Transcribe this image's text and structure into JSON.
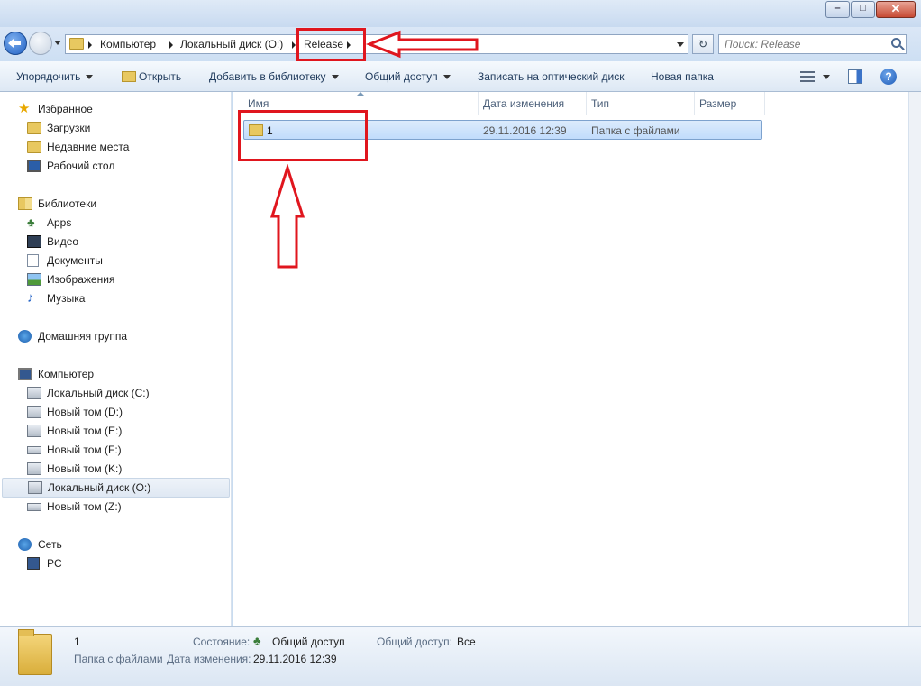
{
  "window": {
    "minimize_glyph": "–",
    "maximize_glyph": "□",
    "close_glyph": "✕"
  },
  "address": {
    "crumbs": [
      "Компьютер",
      "Локальный диск (O:)",
      "Release"
    ]
  },
  "search": {
    "placeholder": "Поиск: Release"
  },
  "toolbar": {
    "organize": "Упорядочить",
    "open": "Открыть",
    "add_to_library": "Добавить в библиотеку",
    "share": "Общий доступ",
    "burn": "Записать на оптический диск",
    "new_folder": "Новая папка",
    "help": "?"
  },
  "nav": {
    "favorites": {
      "title": "Избранное",
      "items": [
        "Загрузки",
        "Недавние места",
        "Рабочий стол"
      ]
    },
    "libraries": {
      "title": "Библиотеки",
      "items": [
        "Apps",
        "Видео",
        "Документы",
        "Изображения",
        "Музыка"
      ]
    },
    "homegroup": {
      "title": "Домашняя группа"
    },
    "computer": {
      "title": "Компьютер",
      "items": [
        "Локальный диск (C:)",
        "Новый том (D:)",
        "Новый том (E:)",
        "Новый том (F:)",
        "Новый том (K:)",
        "Локальный диск (O:)",
        "Новый том (Z:)"
      ]
    },
    "network": {
      "title": "Сеть",
      "items": [
        "PC"
      ]
    }
  },
  "columns": {
    "name": "Имя",
    "date": "Дата изменения",
    "type": "Тип",
    "size": "Размер"
  },
  "files": [
    {
      "name": "1",
      "date": "29.11.2016 12:39",
      "type": "Папка с файлами",
      "size": ""
    }
  ],
  "details": {
    "name": "1",
    "type": "Папка с файлами",
    "state_label": "Состояние:",
    "state_value": "Общий доступ",
    "date_label": "Дата изменения:",
    "date_value": "29.11.2016 12:39",
    "share_label": "Общий доступ:",
    "share_value": "Все"
  },
  "colors": {
    "annotation": "#e0161e",
    "selection": "#c1dcfc"
  }
}
